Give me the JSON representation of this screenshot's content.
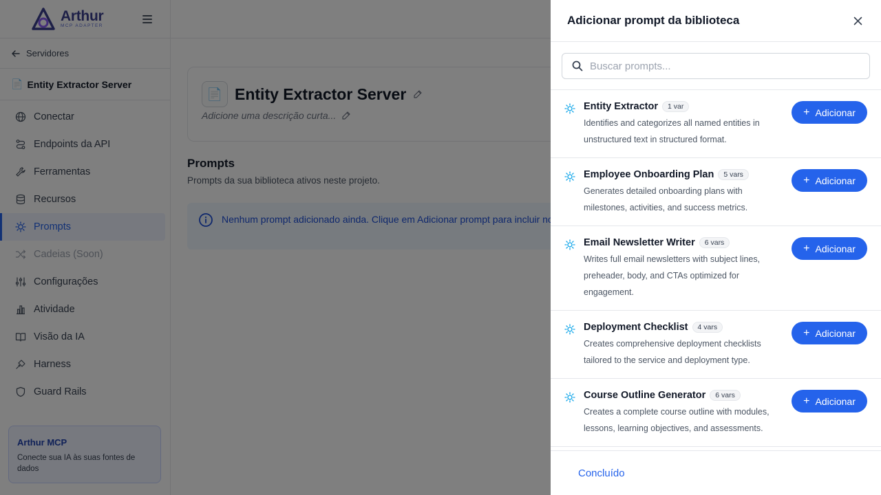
{
  "app": {
    "brand_name": "Arthur",
    "brand_sub": "MCP ADAPTER",
    "back_label": "Servidores",
    "server_name": "Entity Extractor Server",
    "nav": [
      {
        "label": "Conectar",
        "icon": "globe-icon"
      },
      {
        "label": "Endpoints da API",
        "icon": "endpoints-icon"
      },
      {
        "label": "Ferramentas",
        "icon": "wrench-icon"
      },
      {
        "label": "Recursos",
        "icon": "database-icon"
      },
      {
        "label": "Prompts",
        "icon": "lightbulb-icon",
        "active": true
      },
      {
        "label": "Cadeias (Soon)",
        "icon": "shuffle-icon",
        "disabled": true
      },
      {
        "label": "Configurações",
        "icon": "sliders-icon"
      },
      {
        "label": "Atividade",
        "icon": "bar-chart-icon"
      },
      {
        "label": "Visão da IA",
        "icon": "book-icon"
      },
      {
        "label": "Harness",
        "icon": "harness-icon"
      },
      {
        "label": "Guard Rails",
        "icon": "shield-icon"
      }
    ],
    "promo": {
      "title": "Arthur MCP",
      "text": "Conecte sua IA às suas fontes de dados"
    },
    "header": {
      "icon": "📄",
      "title": "Entity Extractor Server",
      "description_placeholder": "Adicione uma descrição curta..."
    },
    "section": {
      "title": "Prompts",
      "subtitle": "Prompts da sua biblioteca ativos neste projeto."
    },
    "info": {
      "text": "Nenhum prompt adicionado ainda. Clique em Adicionar prompt para incluir novos."
    }
  },
  "drawer": {
    "title": "Adicionar prompt da biblioteca",
    "search_placeholder": "Buscar prompts...",
    "add_label": "Adicionar",
    "done_label": "Concluído",
    "prompts": [
      {
        "name": "Entity Extractor",
        "vars": "1 var",
        "description": "Identifies and categorizes all named entities in unstructured text in structured format."
      },
      {
        "name": "Employee Onboarding Plan",
        "vars": "5 vars",
        "description": "Generates detailed onboarding plans with milestones, activities, and success metrics."
      },
      {
        "name": "Email Newsletter Writer",
        "vars": "6 vars",
        "description": "Writes full email newsletters with subject lines, preheader, body, and CTAs optimized for engagement."
      },
      {
        "name": "Deployment Checklist",
        "vars": "4 vars",
        "description": "Creates comprehensive deployment checklists tailored to the service and deployment type."
      },
      {
        "name": "Course Outline Generator",
        "vars": "6 vars",
        "description": "Creates a complete course outline with modules, lessons, learning objectives, and assessments."
      }
    ]
  },
  "colors": {
    "accent": "#2563eb",
    "overlay": "rgba(0,0,0,0.5)",
    "prompt_icon": "#0ea5e9"
  }
}
